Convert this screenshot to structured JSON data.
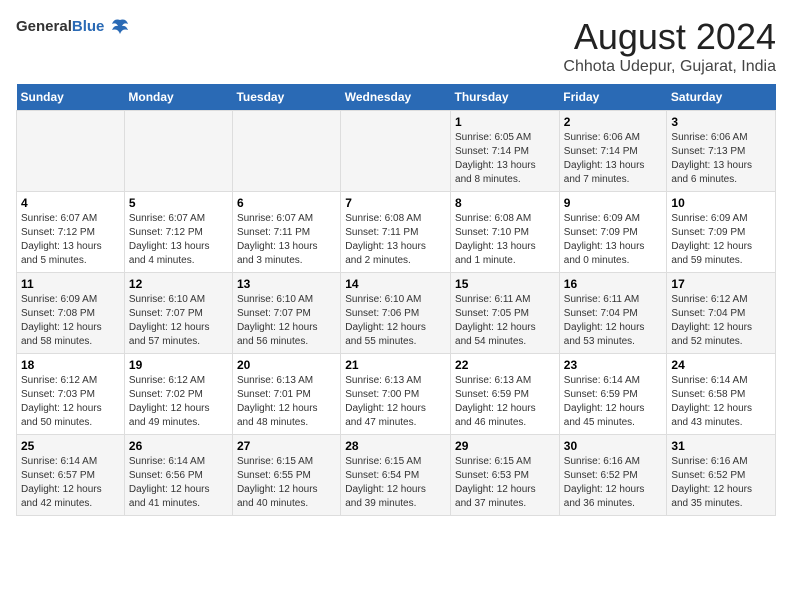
{
  "logo": {
    "general": "General",
    "blue": "Blue"
  },
  "header": {
    "title": "August 2024",
    "subtitle": "Chhota Udepur, Gujarat, India"
  },
  "days_of_week": [
    "Sunday",
    "Monday",
    "Tuesday",
    "Wednesday",
    "Thursday",
    "Friday",
    "Saturday"
  ],
  "weeks": [
    [
      {
        "day": "",
        "info": ""
      },
      {
        "day": "",
        "info": ""
      },
      {
        "day": "",
        "info": ""
      },
      {
        "day": "",
        "info": ""
      },
      {
        "day": "1",
        "info": "Sunrise: 6:05 AM\nSunset: 7:14 PM\nDaylight: 13 hours\nand 8 minutes."
      },
      {
        "day": "2",
        "info": "Sunrise: 6:06 AM\nSunset: 7:14 PM\nDaylight: 13 hours\nand 7 minutes."
      },
      {
        "day": "3",
        "info": "Sunrise: 6:06 AM\nSunset: 7:13 PM\nDaylight: 13 hours\nand 6 minutes."
      }
    ],
    [
      {
        "day": "4",
        "info": "Sunrise: 6:07 AM\nSunset: 7:12 PM\nDaylight: 13 hours\nand 5 minutes."
      },
      {
        "day": "5",
        "info": "Sunrise: 6:07 AM\nSunset: 7:12 PM\nDaylight: 13 hours\nand 4 minutes."
      },
      {
        "day": "6",
        "info": "Sunrise: 6:07 AM\nSunset: 7:11 PM\nDaylight: 13 hours\nand 3 minutes."
      },
      {
        "day": "7",
        "info": "Sunrise: 6:08 AM\nSunset: 7:11 PM\nDaylight: 13 hours\nand 2 minutes."
      },
      {
        "day": "8",
        "info": "Sunrise: 6:08 AM\nSunset: 7:10 PM\nDaylight: 13 hours\nand 1 minute."
      },
      {
        "day": "9",
        "info": "Sunrise: 6:09 AM\nSunset: 7:09 PM\nDaylight: 13 hours\nand 0 minutes."
      },
      {
        "day": "10",
        "info": "Sunrise: 6:09 AM\nSunset: 7:09 PM\nDaylight: 12 hours\nand 59 minutes."
      }
    ],
    [
      {
        "day": "11",
        "info": "Sunrise: 6:09 AM\nSunset: 7:08 PM\nDaylight: 12 hours\nand 58 minutes."
      },
      {
        "day": "12",
        "info": "Sunrise: 6:10 AM\nSunset: 7:07 PM\nDaylight: 12 hours\nand 57 minutes."
      },
      {
        "day": "13",
        "info": "Sunrise: 6:10 AM\nSunset: 7:07 PM\nDaylight: 12 hours\nand 56 minutes."
      },
      {
        "day": "14",
        "info": "Sunrise: 6:10 AM\nSunset: 7:06 PM\nDaylight: 12 hours\nand 55 minutes."
      },
      {
        "day": "15",
        "info": "Sunrise: 6:11 AM\nSunset: 7:05 PM\nDaylight: 12 hours\nand 54 minutes."
      },
      {
        "day": "16",
        "info": "Sunrise: 6:11 AM\nSunset: 7:04 PM\nDaylight: 12 hours\nand 53 minutes."
      },
      {
        "day": "17",
        "info": "Sunrise: 6:12 AM\nSunset: 7:04 PM\nDaylight: 12 hours\nand 52 minutes."
      }
    ],
    [
      {
        "day": "18",
        "info": "Sunrise: 6:12 AM\nSunset: 7:03 PM\nDaylight: 12 hours\nand 50 minutes."
      },
      {
        "day": "19",
        "info": "Sunrise: 6:12 AM\nSunset: 7:02 PM\nDaylight: 12 hours\nand 49 minutes."
      },
      {
        "day": "20",
        "info": "Sunrise: 6:13 AM\nSunset: 7:01 PM\nDaylight: 12 hours\nand 48 minutes."
      },
      {
        "day": "21",
        "info": "Sunrise: 6:13 AM\nSunset: 7:00 PM\nDaylight: 12 hours\nand 47 minutes."
      },
      {
        "day": "22",
        "info": "Sunrise: 6:13 AM\nSunset: 6:59 PM\nDaylight: 12 hours\nand 46 minutes."
      },
      {
        "day": "23",
        "info": "Sunrise: 6:14 AM\nSunset: 6:59 PM\nDaylight: 12 hours\nand 45 minutes."
      },
      {
        "day": "24",
        "info": "Sunrise: 6:14 AM\nSunset: 6:58 PM\nDaylight: 12 hours\nand 43 minutes."
      }
    ],
    [
      {
        "day": "25",
        "info": "Sunrise: 6:14 AM\nSunset: 6:57 PM\nDaylight: 12 hours\nand 42 minutes."
      },
      {
        "day": "26",
        "info": "Sunrise: 6:14 AM\nSunset: 6:56 PM\nDaylight: 12 hours\nand 41 minutes."
      },
      {
        "day": "27",
        "info": "Sunrise: 6:15 AM\nSunset: 6:55 PM\nDaylight: 12 hours\nand 40 minutes."
      },
      {
        "day": "28",
        "info": "Sunrise: 6:15 AM\nSunset: 6:54 PM\nDaylight: 12 hours\nand 39 minutes."
      },
      {
        "day": "29",
        "info": "Sunrise: 6:15 AM\nSunset: 6:53 PM\nDaylight: 12 hours\nand 37 minutes."
      },
      {
        "day": "30",
        "info": "Sunrise: 6:16 AM\nSunset: 6:52 PM\nDaylight: 12 hours\nand 36 minutes."
      },
      {
        "day": "31",
        "info": "Sunrise: 6:16 AM\nSunset: 6:52 PM\nDaylight: 12 hours\nand 35 minutes."
      }
    ]
  ]
}
